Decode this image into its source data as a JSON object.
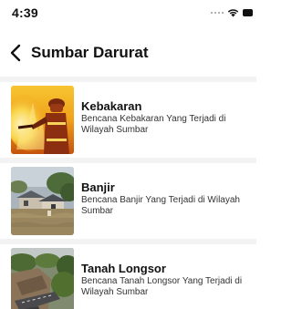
{
  "status_bar": {
    "time": "4:39"
  },
  "nav": {
    "back_icon": "chevron-left-icon",
    "title": "Sumbar Darurat"
  },
  "items": [
    {
      "title": "Kebakaran",
      "description": "Bencana Kebakaran Yang Terjadi di Wilayah Sumbar",
      "image": "firefighter-photo"
    },
    {
      "title": "Banjir",
      "description": "Bencana Banjir Yang Terjadi di Wilayah Sumbar",
      "image": "flood-photo"
    },
    {
      "title": "Tanah Longsor",
      "description": "Bencana Tanah Longsor Yang Terjadi di Wilayah Sumbar",
      "image": "landslide-photo"
    }
  ]
}
